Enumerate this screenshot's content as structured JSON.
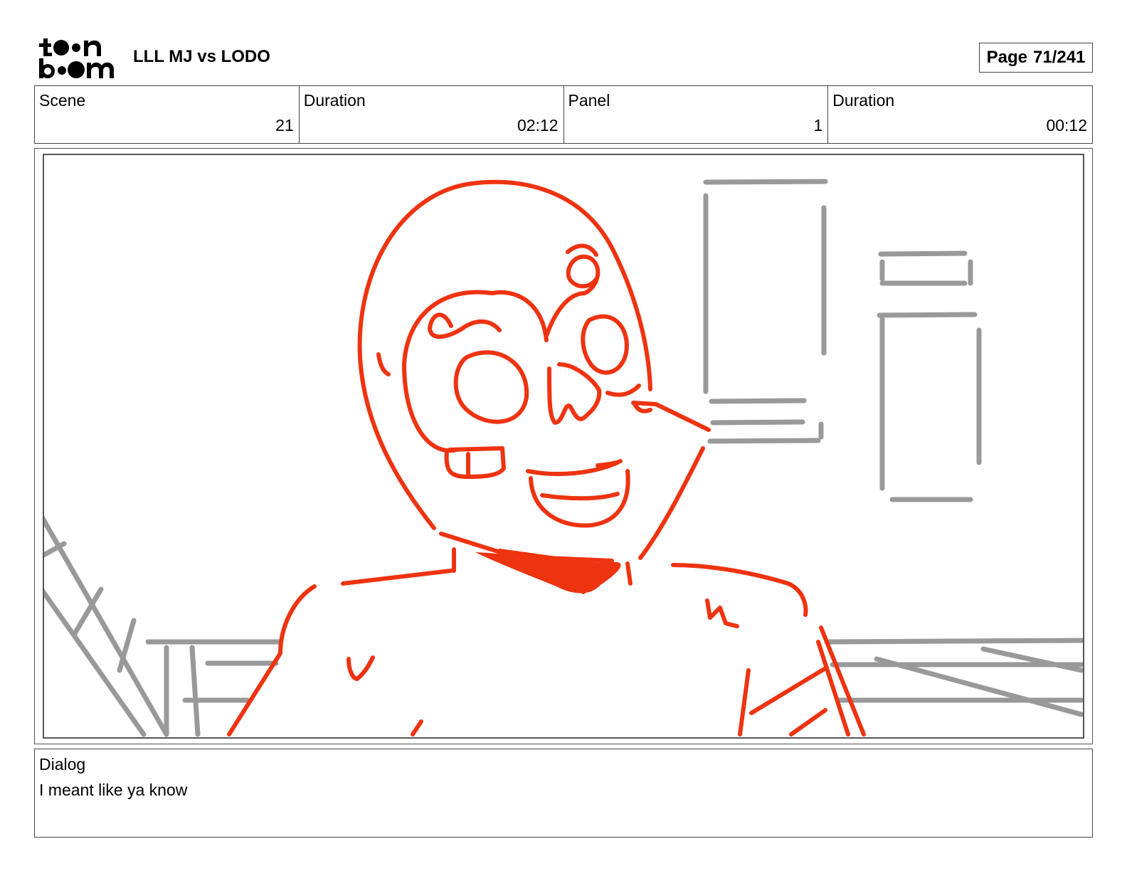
{
  "header": {
    "logo_text": "toon boom",
    "project_title": "LLL MJ vs LODO",
    "page_label": "Page",
    "page_value": "71/241"
  },
  "info": {
    "scene_label": "Scene",
    "scene_value": "21",
    "scene_duration_label": "Duration",
    "scene_duration_value": "02:12",
    "panel_label": "Panel",
    "panel_value": "1",
    "panel_duration_label": "Duration",
    "panel_duration_value": "00:12"
  },
  "dialog": {
    "label": "Dialog",
    "text": "I meant like ya know"
  },
  "colors": {
    "sketch_red": "#ee3311",
    "sketch_gray": "#999999"
  }
}
